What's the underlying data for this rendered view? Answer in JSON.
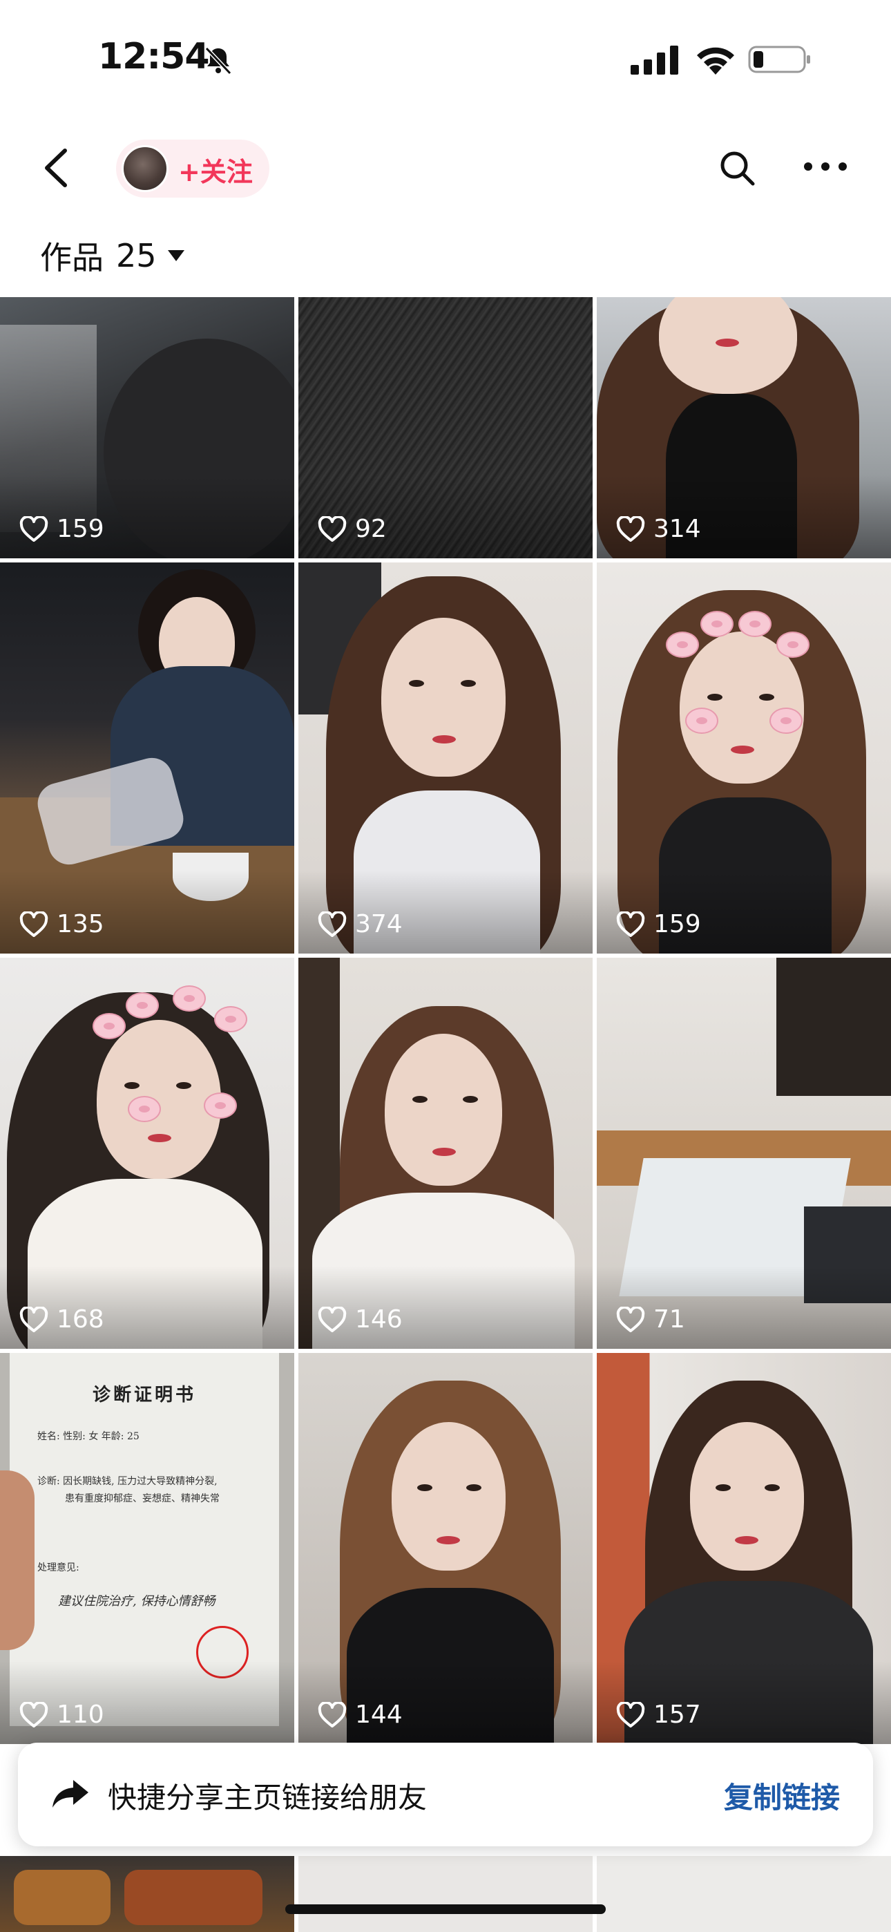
{
  "status_bar": {
    "time": "12:54",
    "silent_icon": "bell-slash-icon",
    "signal_icon": "cellular-signal-icon",
    "wifi_icon": "wifi-icon",
    "battery_icon": "battery-low-icon"
  },
  "nav": {
    "back_icon": "chevron-left-icon",
    "follow_label": "+关注",
    "search_icon": "search-icon",
    "more_icon": "ellipsis-icon"
  },
  "works": {
    "label": "作品",
    "count": "25",
    "caret_icon": "caret-down-icon"
  },
  "grid": {
    "items": [
      {
        "likes": "159",
        "scene": "night street"
      },
      {
        "likes": "92",
        "scene": "dark rain"
      },
      {
        "likes": "314",
        "scene": "portrait outdoor"
      },
      {
        "likes": "135",
        "scene": "dining table"
      },
      {
        "likes": "374",
        "scene": "portrait white top"
      },
      {
        "likes": "159",
        "scene": "portrait pig stickers"
      },
      {
        "likes": "168",
        "scene": "portrait pig stickers"
      },
      {
        "likes": "146",
        "scene": "portrait white cardigan"
      },
      {
        "likes": "71",
        "scene": "restaurant interior"
      },
      {
        "likes": "110",
        "scene": "diagnosis certificate"
      },
      {
        "likes": "144",
        "scene": "portrait black top"
      },
      {
        "likes": "157",
        "scene": "portrait black shirt"
      }
    ],
    "document": {
      "title": "诊断证明书",
      "line1": "姓名:   性别: 女   年龄: 25",
      "line2": "诊断: 因长期缺钱, 压力过大导致精神分裂,",
      "line3": "患有重度抑郁症、妄想症、精神失常",
      "line4": "处理意见:",
      "line5": "建议住院治疗, 保持心情舒畅"
    },
    "like_icon": "heart-outline-icon"
  },
  "share_banner": {
    "icon": "share-arrow-icon",
    "text": "快捷分享主页链接给朋友",
    "action": "复制链接"
  },
  "colors": {
    "follow_accent": "#f2375a",
    "follow_chip_bg": "#fdeef1",
    "link_blue": "#1e5aa8"
  }
}
